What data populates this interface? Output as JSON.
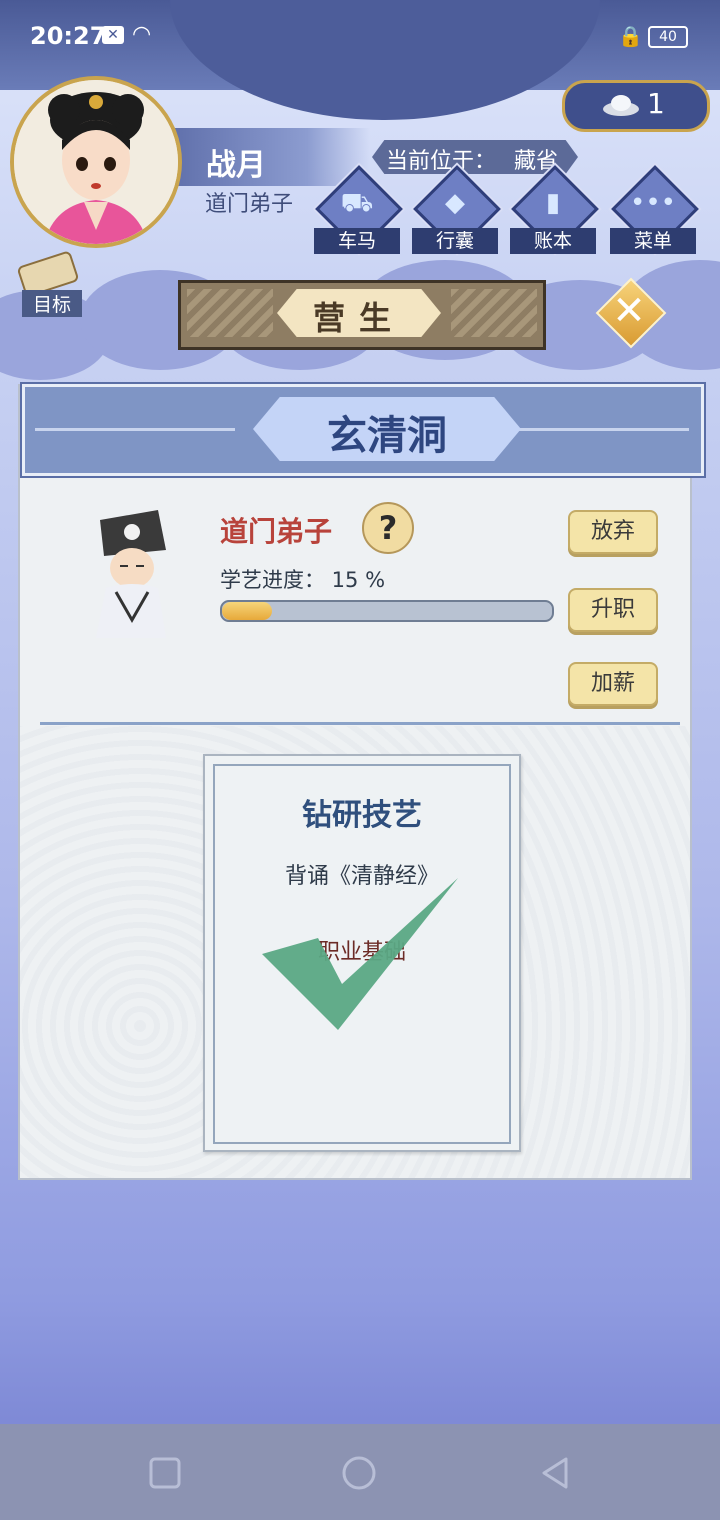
{
  "status_bar": {
    "time": "20:27",
    "battery": "40"
  },
  "player": {
    "name": "战月",
    "title": "道门弟子"
  },
  "currency": {
    "icon": "silver-ingot-icon",
    "count": "1"
  },
  "location": {
    "label": "当前位于：",
    "value": "藏省"
  },
  "nav": [
    {
      "label": "车马",
      "icon": "carriage-icon"
    },
    {
      "label": "行囊",
      "icon": "bag-icon"
    },
    {
      "label": "账本",
      "icon": "ledger-icon"
    },
    {
      "label": "菜单",
      "icon": "more-icon"
    }
  ],
  "goal": {
    "label": "目标"
  },
  "page_banner": {
    "title": "营生"
  },
  "venue": {
    "name": "玄清洞"
  },
  "job": {
    "title": "道门弟子",
    "help": "?",
    "progress_label": "学艺进度： 15 %",
    "progress_fraction": 0.15
  },
  "actions": {
    "give_up": "放弃",
    "promote": "升职",
    "raise": "加薪"
  },
  "task_card": {
    "title": "钻研技艺",
    "task": "背诵《清静经》",
    "requirement": "职业基础"
  },
  "colors": {
    "accent_gold": "#f4e4a8",
    "header_blue": "#7f95c5",
    "check_green": "#5aa884"
  }
}
